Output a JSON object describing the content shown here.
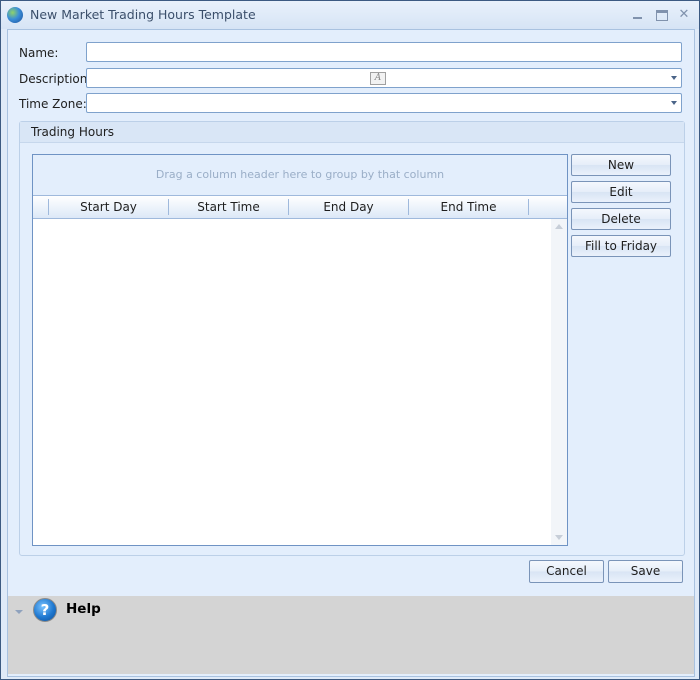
{
  "window": {
    "title": "New Market Trading Hours Template",
    "controls": {
      "minimize": "minimize",
      "maximize": "maximize",
      "close": "✕"
    }
  },
  "form": {
    "name": {
      "label": "Name:",
      "value": ""
    },
    "description": {
      "label": "Description:",
      "value": "",
      "icon": "rich-text-icon",
      "icon_glyph": "A"
    },
    "time_zone": {
      "label": "Time Zone:",
      "value": ""
    }
  },
  "trading_hours": {
    "title": "Trading Hours",
    "grid": {
      "group_panel_hint": "Drag a column header here to group by that column",
      "columns": [
        "Start Day",
        "Start Time",
        "End Day",
        "End Time"
      ],
      "rows": []
    },
    "buttons": {
      "new": "New",
      "edit": "Edit",
      "delete": "Delete",
      "fill_to_friday": "Fill to Friday"
    }
  },
  "footer": {
    "cancel": "Cancel",
    "save": "Save"
  },
  "help": {
    "title": "Help",
    "icon_glyph": "?"
  }
}
